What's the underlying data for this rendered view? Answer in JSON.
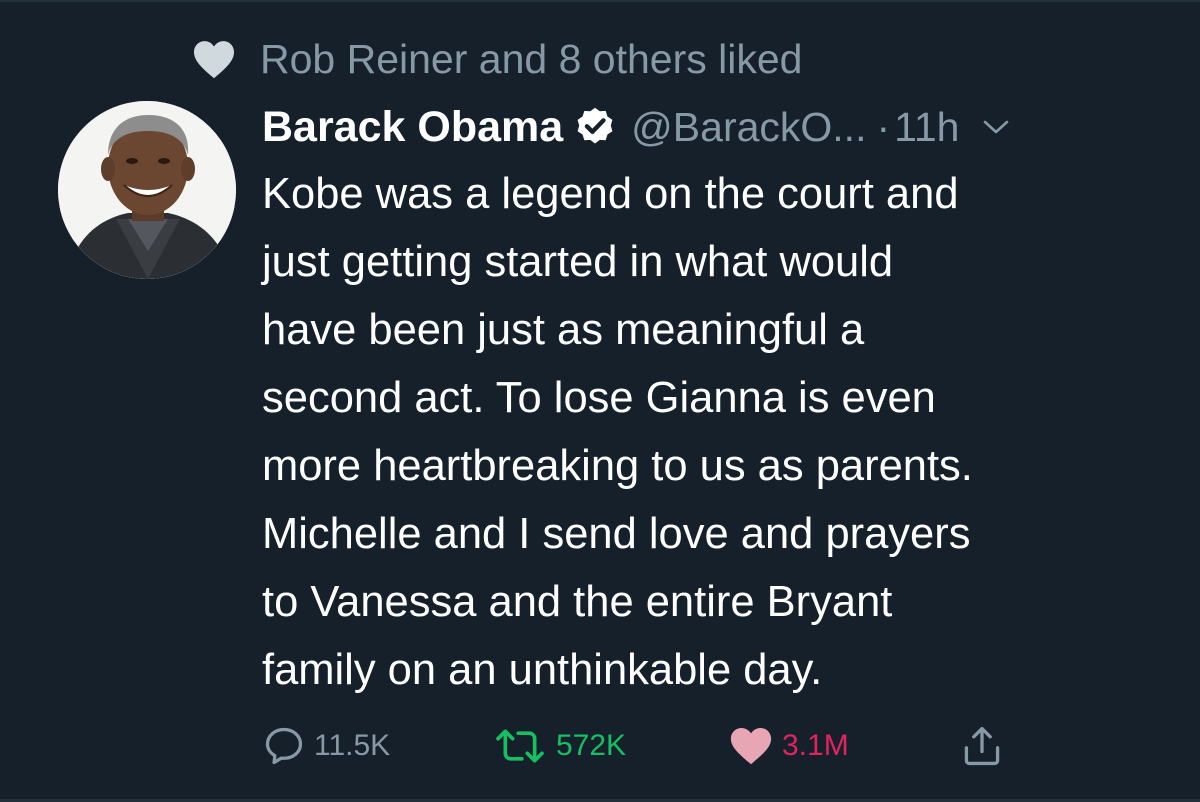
{
  "social_context": {
    "text": "Rob Reiner and 8 others liked",
    "icon": "heart-icon"
  },
  "author": {
    "display_name": "Barack Obama",
    "handle": "@BarackO...",
    "separator": "·",
    "time": "11h",
    "verified": true
  },
  "tweet": {
    "lines": [
      "Kobe was a legend on the court and",
      "just getting started in what would",
      "have been just as meaningful a",
      "second act. To lose Gianna is even",
      "more heartbreaking to us as parents.",
      "Michelle and I send love and prayers",
      "to Vanessa and the entire Bryant",
      "family on an unthinkable day."
    ]
  },
  "actions": {
    "reply": {
      "icon": "reply-icon",
      "count": "11.5K"
    },
    "retweet": {
      "icon": "retweet-icon",
      "count": "572K"
    },
    "like": {
      "icon": "heart-icon",
      "count": "3.1M"
    },
    "share": {
      "icon": "share-icon"
    }
  },
  "colors": {
    "background": "#15202b",
    "secondary_text": "#8899a6",
    "retweet_green": "#17bf63",
    "like_pink": "#e0245e"
  }
}
